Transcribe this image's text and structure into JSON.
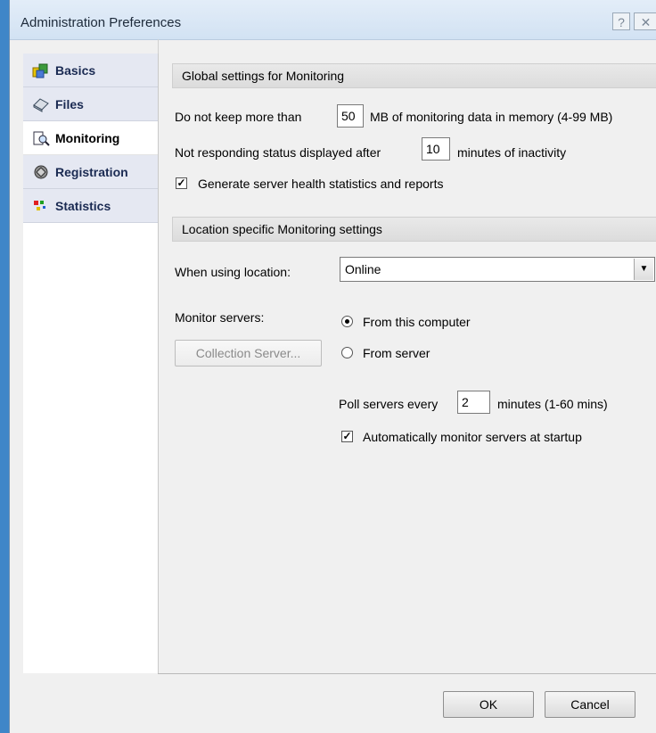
{
  "window": {
    "title": "Administration Preferences",
    "help_button": "?",
    "close_button": "✕"
  },
  "sidebar": {
    "items": [
      {
        "label": "Basics",
        "icon": "basics-icon",
        "active": false
      },
      {
        "label": "Files",
        "icon": "files-icon",
        "active": false
      },
      {
        "label": "Monitoring",
        "icon": "monitoring-icon",
        "active": true
      },
      {
        "label": "Registration",
        "icon": "registration-icon",
        "active": false
      },
      {
        "label": "Statistics",
        "icon": "statistics-icon",
        "active": false
      }
    ]
  },
  "global": {
    "header": "Global settings for Monitoring",
    "keep_prefix": "Do not keep more than",
    "keep_value": "50",
    "keep_suffix": "MB of monitoring data in memory (4-99 MB)",
    "nr_prefix": "Not responding status displayed after",
    "nr_value": "10",
    "nr_suffix": "minutes of inactivity",
    "health_label": "Generate server health statistics and reports",
    "health_checked": true
  },
  "location": {
    "header": "Location specific Monitoring settings",
    "when_label": "When using location:",
    "when_value": "Online",
    "monitor_label": "Monitor servers:",
    "collection_button": "Collection Server...",
    "radio_this": "From this computer",
    "radio_server": "From server",
    "selected_radio": "this",
    "poll_prefix": "Poll servers every",
    "poll_value": "2",
    "poll_suffix": "minutes (1-60 mins)",
    "auto_label": "Automatically monitor servers at startup",
    "auto_checked": true
  },
  "footer": {
    "ok": "OK",
    "cancel": "Cancel"
  }
}
